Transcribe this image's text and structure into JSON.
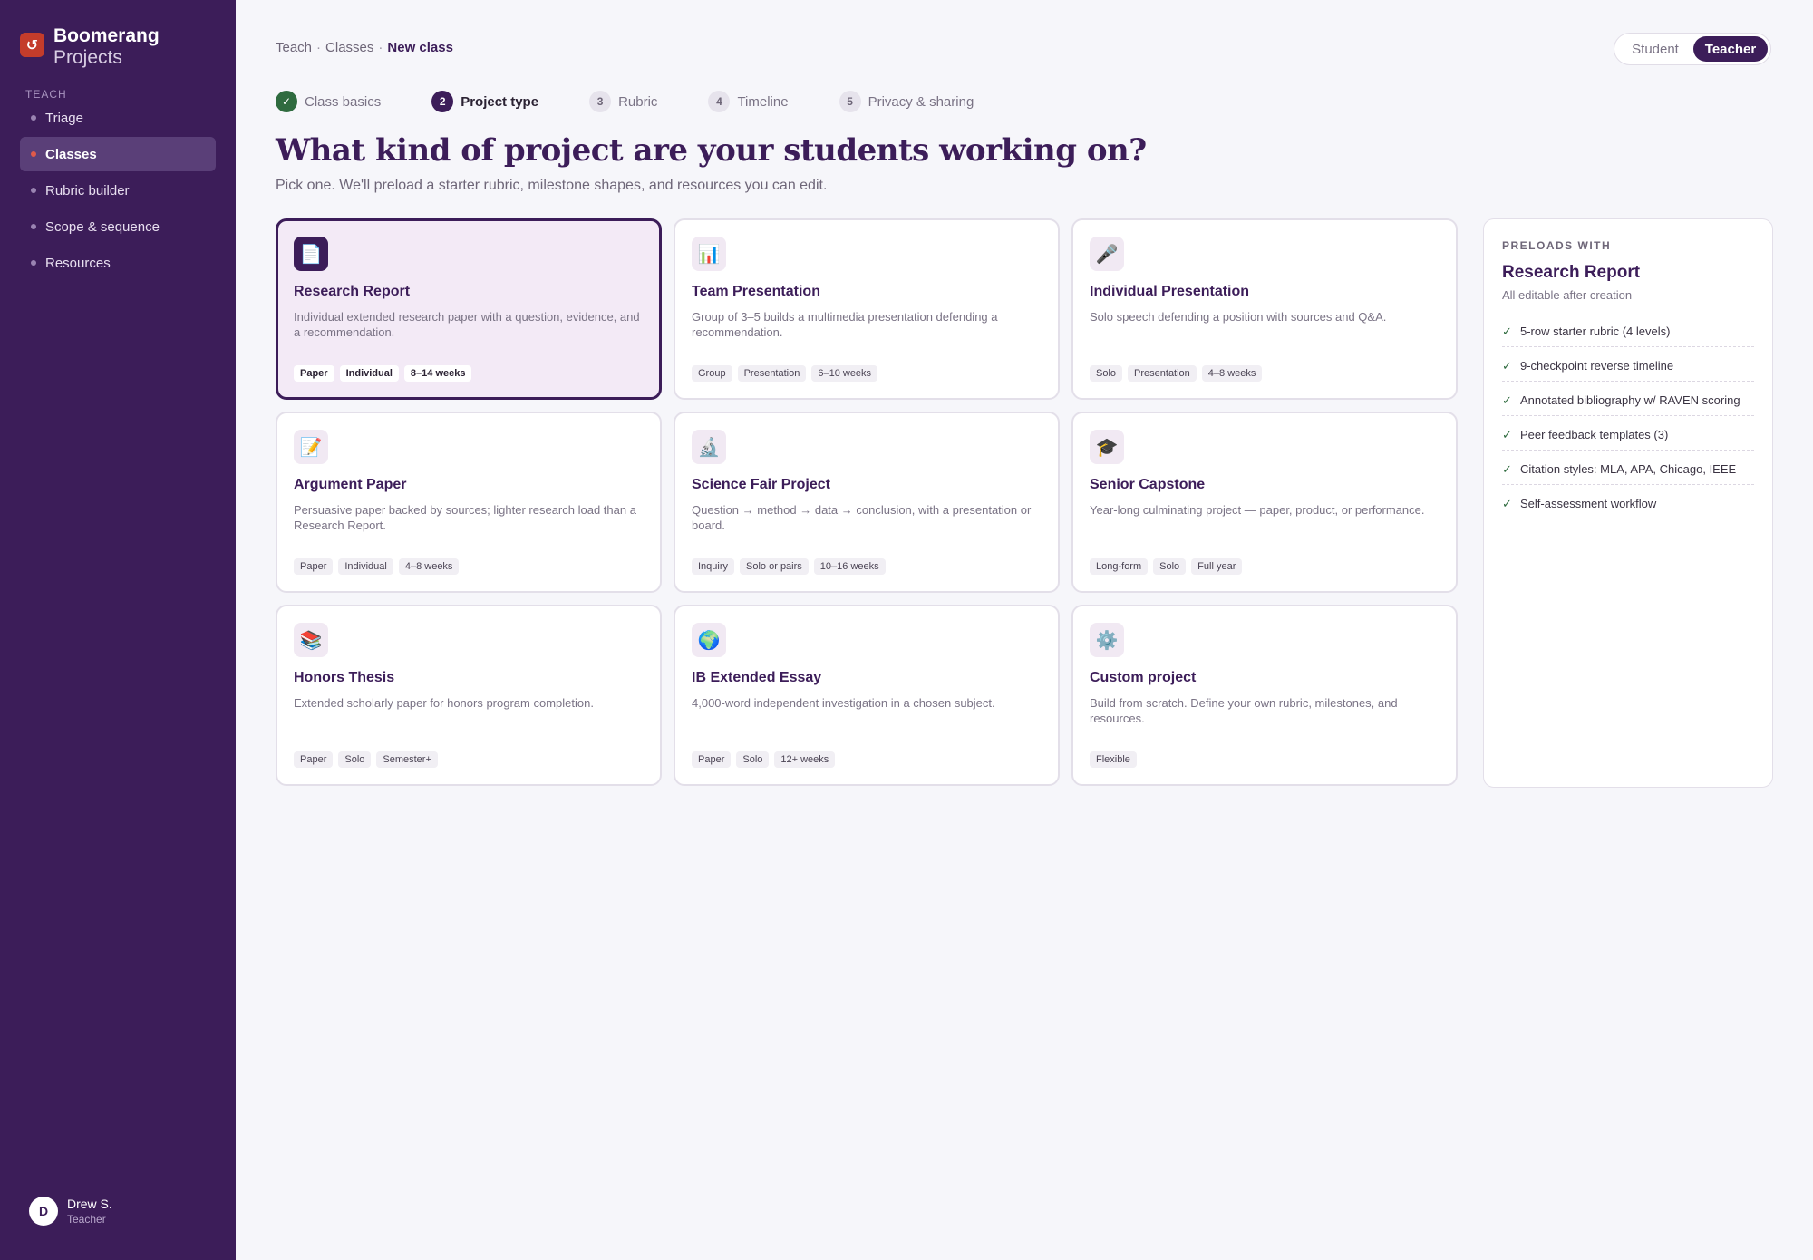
{
  "brand": {
    "logo_glyph": "↺",
    "name": "Boomerang",
    "sub": "Projects"
  },
  "sidebar": {
    "heading": "TEACH",
    "items": [
      {
        "label": "Triage"
      },
      {
        "label": "Classes"
      },
      {
        "label": "Rubric builder"
      },
      {
        "label": "Scope & sequence"
      },
      {
        "label": "Resources"
      }
    ]
  },
  "user": {
    "initial": "D",
    "name": "Drew S.",
    "role": "Teacher"
  },
  "breadcrumb": {
    "items": [
      "Teach",
      "Classes"
    ],
    "sep": "·",
    "current": "New class"
  },
  "role_toggle": {
    "student": "Student",
    "teacher": "Teacher"
  },
  "steps": [
    {
      "marker": "✓",
      "label": "Class basics"
    },
    {
      "marker": "2",
      "label": "Project type"
    },
    {
      "marker": "3",
      "label": "Rubric"
    },
    {
      "marker": "4",
      "label": "Timeline"
    },
    {
      "marker": "5",
      "label": "Privacy & sharing"
    }
  ],
  "page": {
    "title": "What kind of project are your students working on?",
    "subtitle": "Pick one. We'll preload a starter rubric, milestone shapes, and resources you can edit."
  },
  "cards": [
    {
      "icon": "📄",
      "title": "Research Report",
      "desc": "Individual extended research paper with a question, evidence, and a recommendation.",
      "tags": [
        "Paper",
        "Individual",
        "8–14 weeks"
      ]
    },
    {
      "icon": "📊",
      "title": "Team Presentation",
      "desc": "Group of 3–5 builds a multimedia presentation defending a recommendation.",
      "tags": [
        "Group",
        "Presentation",
        "6–10 weeks"
      ]
    },
    {
      "icon": "🎤",
      "title": "Individual Presentation",
      "desc": "Solo speech defending a position with sources and Q&A.",
      "tags": [
        "Solo",
        "Presentation",
        "4–8 weeks"
      ]
    },
    {
      "icon": "📝",
      "title": "Argument Paper",
      "desc": "Persuasive paper backed by sources; lighter research load than a Research Report.",
      "tags": [
        "Paper",
        "Individual",
        "4–8 weeks"
      ]
    },
    {
      "icon": "🔬",
      "title": "Science Fair Project",
      "desc": "Question → method → data → conclusion, with a presentation or board.",
      "tags": [
        "Inquiry",
        "Solo or pairs",
        "10–16 weeks"
      ]
    },
    {
      "icon": "🎓",
      "title": "Senior Capstone",
      "desc": "Year-long culminating project — paper, product, or performance.",
      "tags": [
        "Long-form",
        "Solo",
        "Full year"
      ]
    },
    {
      "icon": "📚",
      "title": "Honors Thesis",
      "desc": "Extended scholarly paper for honors program completion.",
      "tags": [
        "Paper",
        "Solo",
        "Semester+"
      ]
    },
    {
      "icon": "🌍",
      "title": "IB Extended Essay",
      "desc": "4,000-word independent investigation in a chosen subject.",
      "tags": [
        "Paper",
        "Solo",
        "12+ weeks"
      ]
    },
    {
      "icon": "⚙️",
      "title": "Custom project",
      "desc": "Build from scratch. Define your own rubric, milestones, and resources.",
      "tags": [
        "Flexible"
      ]
    }
  ],
  "panel": {
    "eyebrow": "PRELOADS WITH",
    "title": "Research Report",
    "sub": "All editable after creation",
    "check_glyph": "✓",
    "items": [
      "5-row starter rubric (4 levels)",
      "9-checkpoint reverse timeline",
      "Annotated bibliography w/ RAVEN scoring",
      "Peer feedback templates (3)",
      "Citation styles: MLA, APA, Chicago, IEEE",
      "Self-assessment workflow"
    ]
  },
  "colors": {
    "sidebar": "#3c1d59",
    "accent": "#3c1d59",
    "logo": "#c43c2b",
    "done": "#2f6b3f",
    "background": "#f6f6fa"
  }
}
